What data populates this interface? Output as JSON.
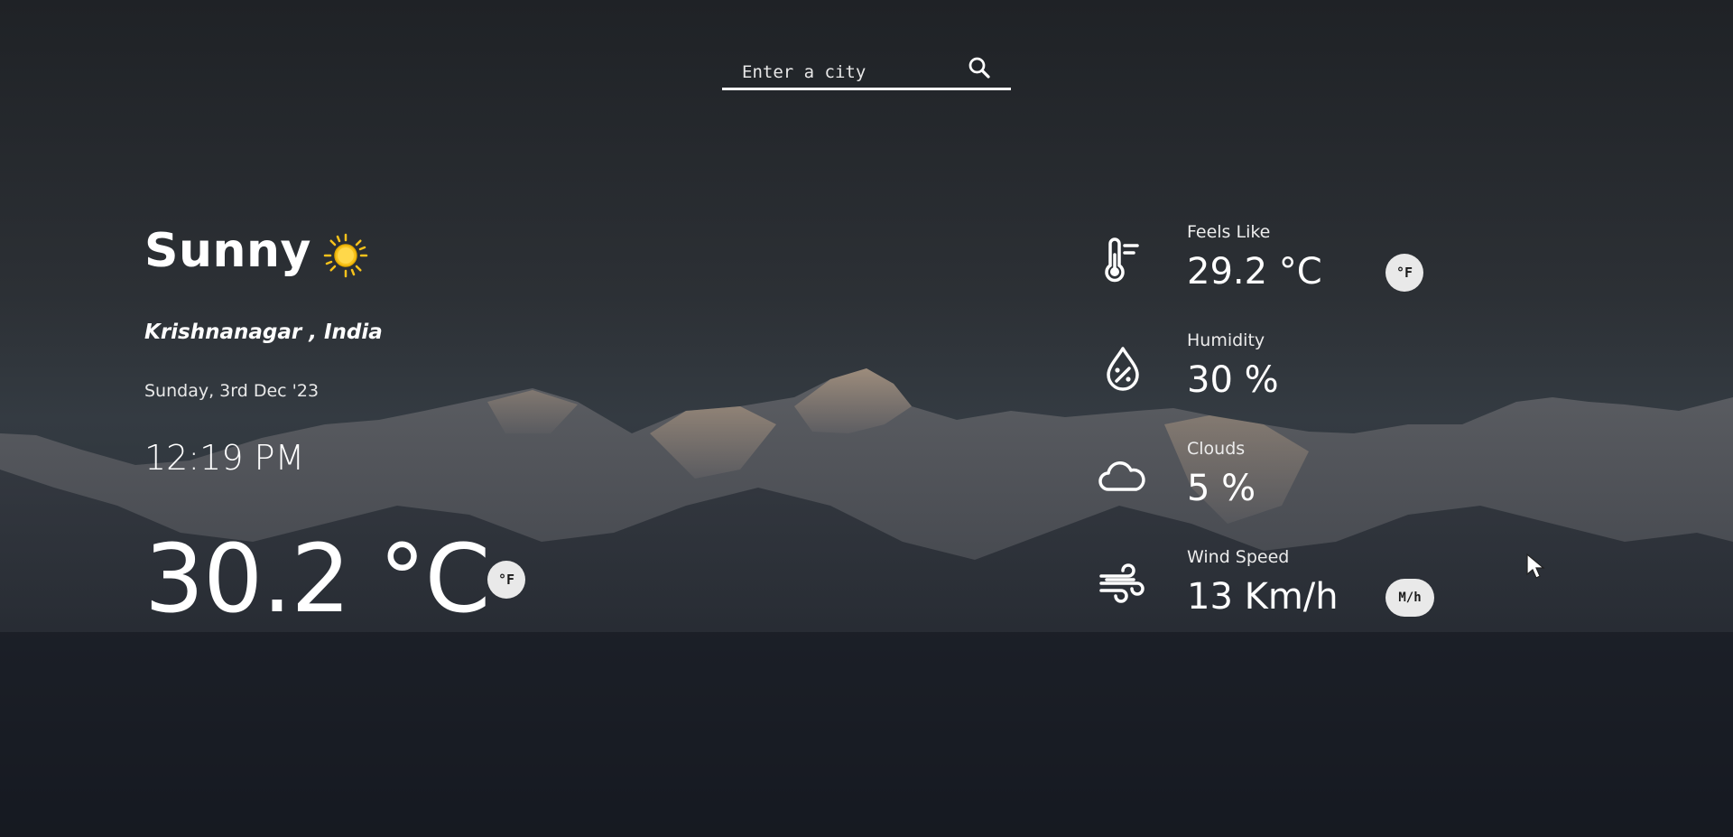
{
  "search": {
    "placeholder": "Enter a city",
    "icon": "search-icon"
  },
  "current": {
    "condition": "Sunny",
    "condition_icon": "sun-icon",
    "location": "Krishnanagar , India",
    "date": "Sunday, 3rd Dec '23",
    "time": "12:19 PM",
    "temperature": "30.2 °C",
    "unit_toggle_label": "°F"
  },
  "details": {
    "feels_like": {
      "label": "Feels Like",
      "value": "29.2 °C",
      "toggle_label": "°F",
      "icon": "thermometer-icon"
    },
    "humidity": {
      "label": "Humidity",
      "value": "30 %",
      "icon": "humidity-drop-icon"
    },
    "clouds": {
      "label": "Clouds",
      "value": "5 %",
      "icon": "cloud-icon"
    },
    "wind_speed": {
      "label": "Wind Speed",
      "value": "13 Km/h",
      "toggle_label": "M/h",
      "icon": "wind-icon"
    }
  },
  "colors": {
    "sun": "#f7c21b",
    "button_bg": "#e9e9e9",
    "text": "#ffffff"
  }
}
